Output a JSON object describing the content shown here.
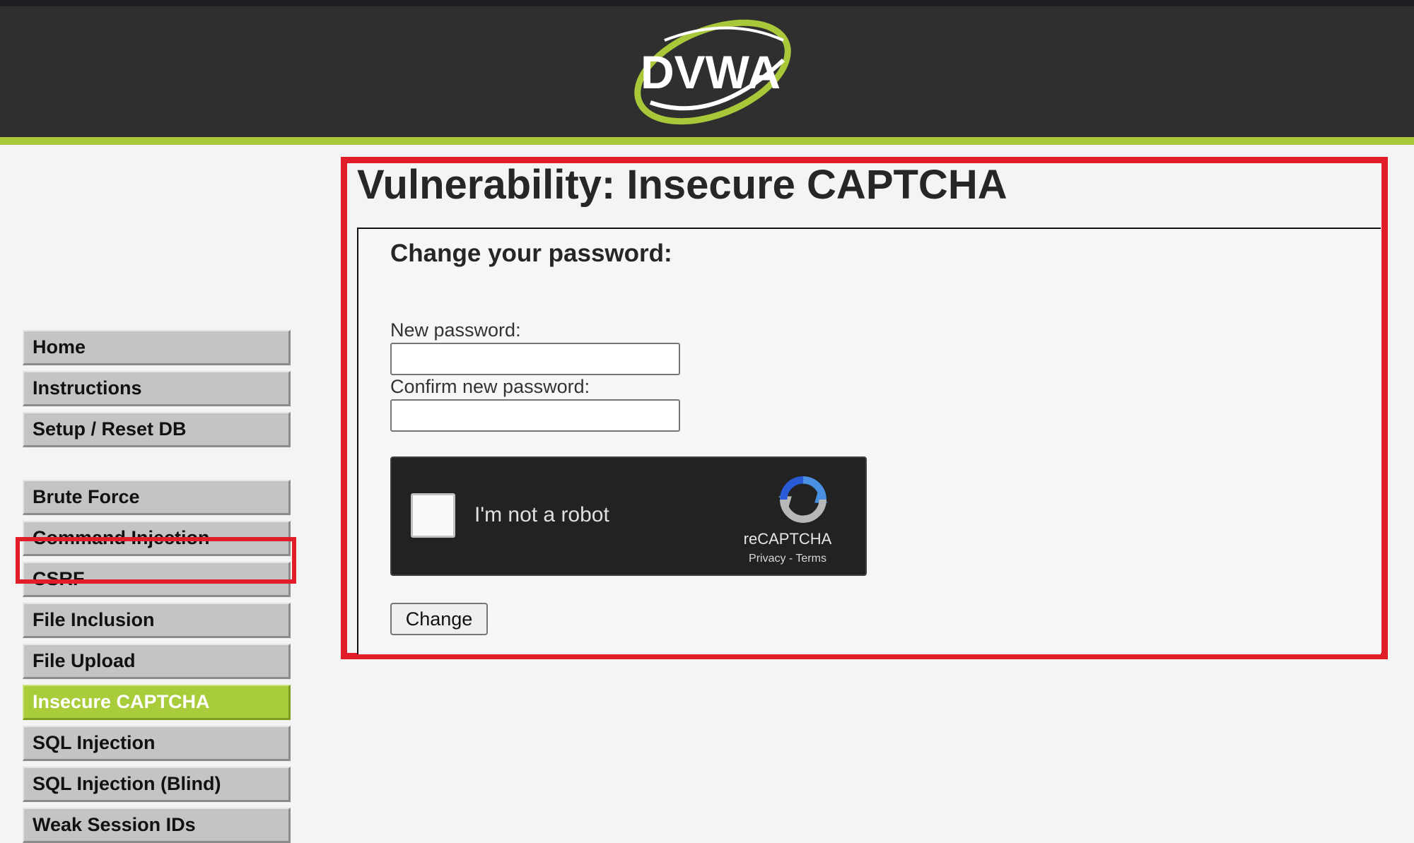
{
  "header": {
    "logo_text": "DVWA"
  },
  "sidebar": {
    "items": [
      {
        "label": "Home"
      },
      {
        "label": "Instructions"
      },
      {
        "label": "Setup / Reset DB"
      },
      {
        "label": "Brute Force"
      },
      {
        "label": "Command Injection"
      },
      {
        "label": "CSRF"
      },
      {
        "label": "File Inclusion"
      },
      {
        "label": "File Upload"
      },
      {
        "label": "Insecure CAPTCHA",
        "active": true
      },
      {
        "label": "SQL Injection"
      },
      {
        "label": "SQL Injection (Blind)"
      },
      {
        "label": "Weak Session IDs"
      }
    ]
  },
  "main": {
    "title": "Vulnerability: Insecure CAPTCHA",
    "form": {
      "heading": "Change your password:",
      "new_password_label": "New password:",
      "new_password_value": "",
      "confirm_password_label": "Confirm new password:",
      "confirm_password_value": "",
      "submit_label": "Change"
    },
    "recaptcha": {
      "label": "I'm not a robot",
      "brand": "reCAPTCHA",
      "privacy": "Privacy",
      "separator": " - ",
      "terms": "Terms"
    }
  },
  "colors": {
    "accent_green": "#a8c83a",
    "highlight_red": "#e11d2a",
    "header_bg": "#2f2f2f"
  }
}
